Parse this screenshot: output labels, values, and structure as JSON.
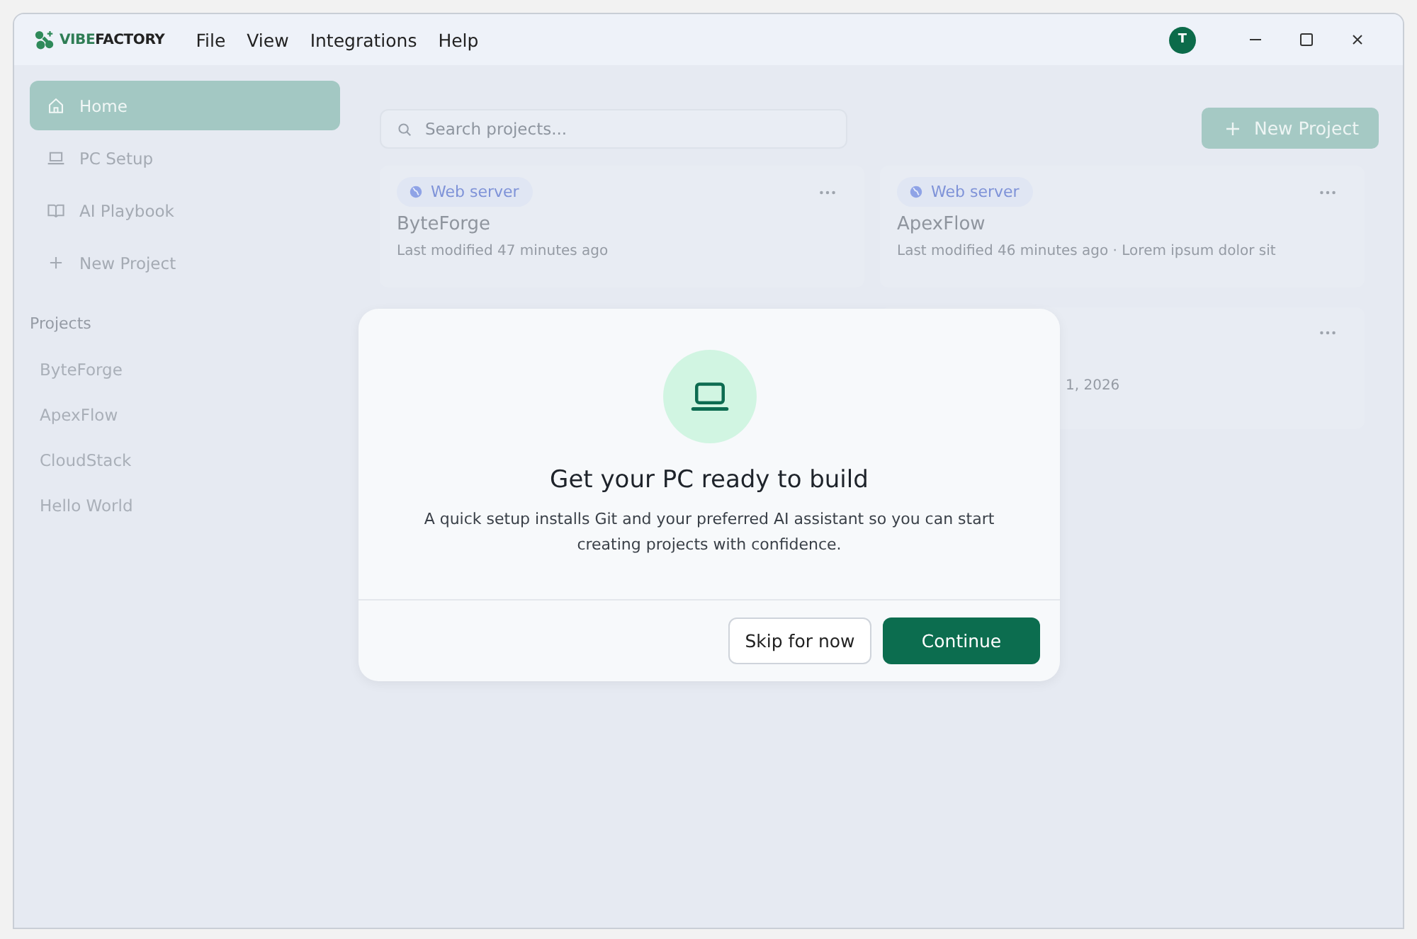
{
  "title_bar": {
    "logo": {
      "accent": "VIBE",
      "rest": "FACTORY"
    },
    "menu": [
      "File",
      "View",
      "Integrations",
      "Help"
    ],
    "avatar": "T"
  },
  "sidebar": {
    "nav": [
      {
        "label": "Home",
        "selected": true
      },
      {
        "label": "PC Setup",
        "selected": false
      },
      {
        "label": "AI Playbook",
        "selected": false
      },
      {
        "label": "New Project",
        "selected": false
      }
    ],
    "section_heading": "Projects",
    "projects": [
      {
        "label": "ByteForge",
        "selected": false
      },
      {
        "label": "ApexFlow",
        "selected": false
      },
      {
        "label": "CloudStack",
        "selected": false
      },
      {
        "label": "Hello World",
        "selected": false
      }
    ]
  },
  "main": {
    "search": {
      "placeholder": "Search projects..."
    },
    "new_project_button": "New Project",
    "cards": [
      {
        "tag": "Web server",
        "name": "ByteForge",
        "meta": "Last modified 47 minutes ago"
      },
      {
        "tag": "Web server",
        "name": "ApexFlow",
        "meta": "Last modified 46 minutes ago  ·  Lorem ipsum dolor sit"
      }
    ],
    "partial_card": {
      "meta": "1, 2026"
    }
  },
  "dialog": {
    "title": "Get your PC ready to build",
    "description": "A quick setup installs Git and your preferred AI assistant so you can start creating projects with confidence.",
    "buttons": [
      {
        "label": "Skip for now",
        "kind": "secondary"
      },
      {
        "label": "Continue",
        "kind": "primary"
      }
    ]
  }
}
